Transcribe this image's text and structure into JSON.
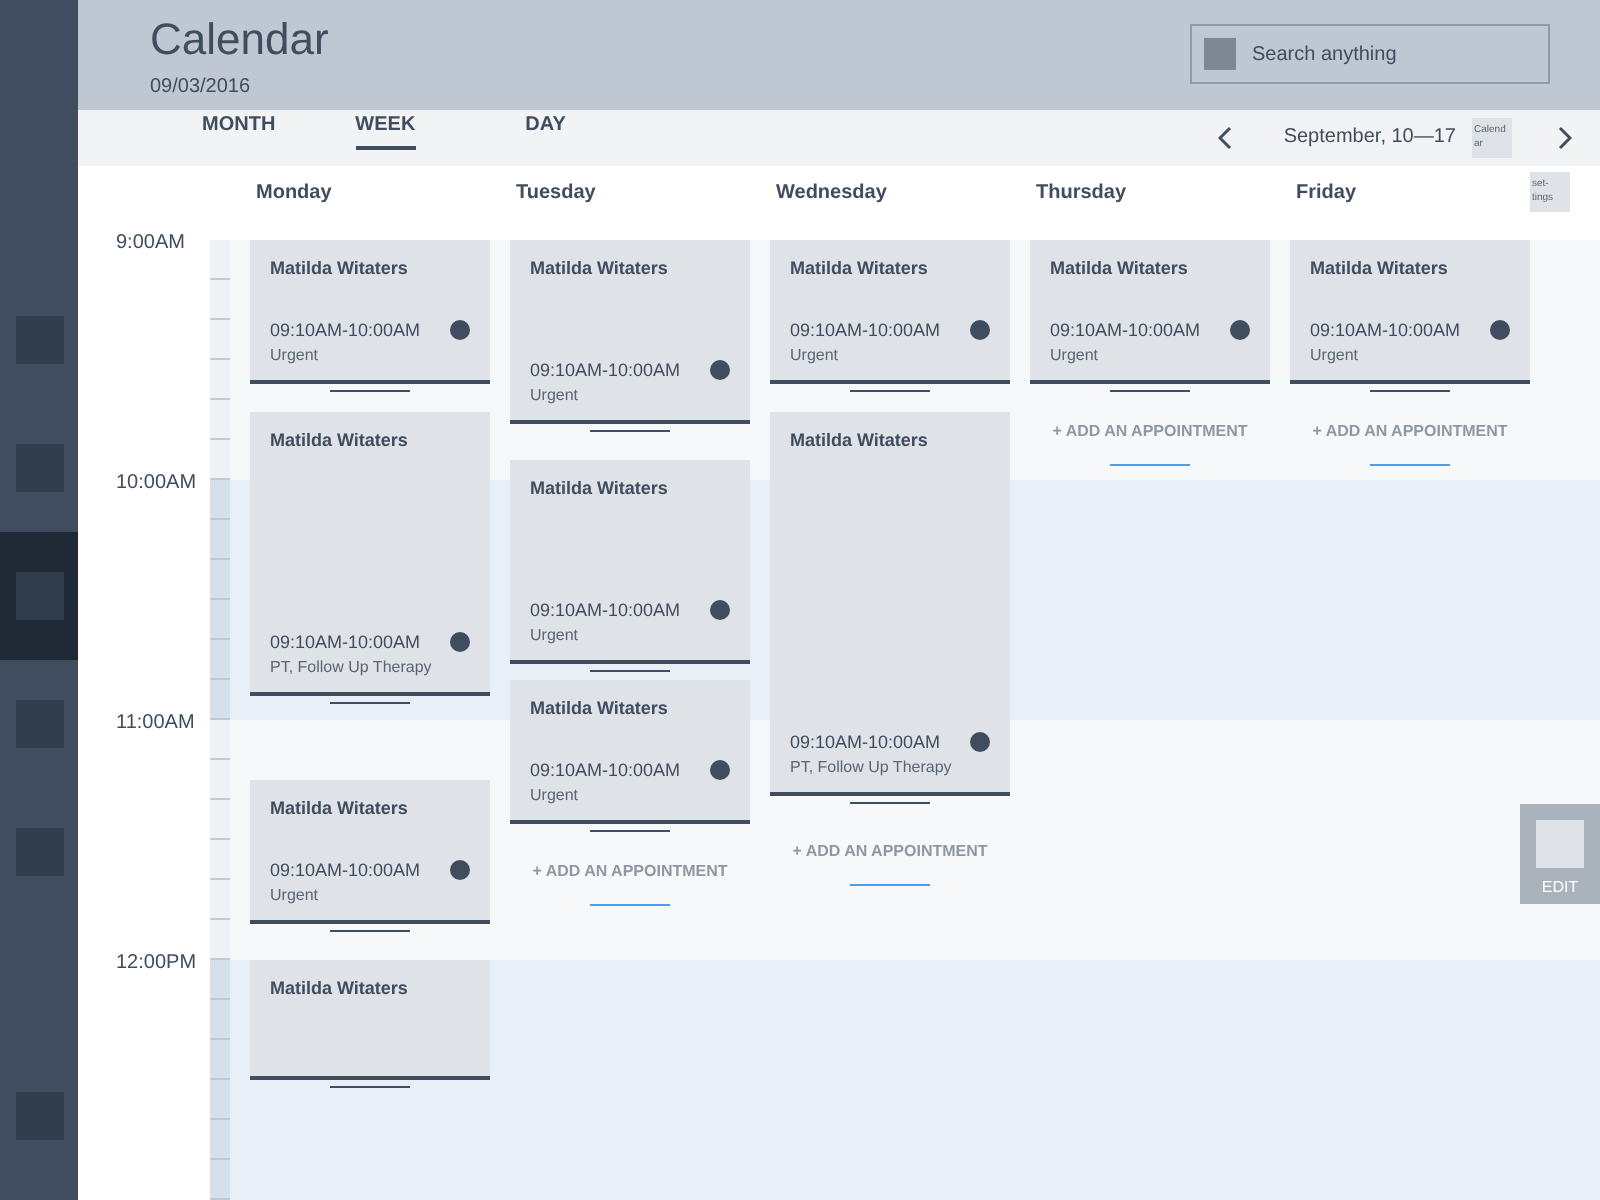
{
  "sidebar": {
    "items": [
      {
        "selected": false
      },
      {
        "selected": false
      },
      {
        "selected": true
      },
      {
        "selected": false
      },
      {
        "selected": false
      },
      {
        "selected": false
      }
    ]
  },
  "header": {
    "title": "Calendar",
    "date": "09/03/2016",
    "search": {
      "placeholder": "Search anything"
    }
  },
  "view_tabs": [
    {
      "label": "MONTH",
      "selected": false
    },
    {
      "label": "WEEK",
      "selected": true
    },
    {
      "label": "DAY",
      "selected": false
    }
  ],
  "date_nav": {
    "range": "September, 10—17",
    "calendar_button": "Calendar"
  },
  "settings_button": "set-tings",
  "times": [
    "9:00AM",
    "10:00AM",
    "11:00AM",
    "12:00PM"
  ],
  "days": [
    {
      "name": "Monday",
      "items": [
        {
          "kind": "appointment",
          "name": "Matilda Witaters",
          "time": "09:10AM-10:00AM",
          "note": "Urgent"
        },
        {
          "kind": "appointment",
          "name": "Matilda Witaters",
          "time": "09:10AM-10:00AM",
          "note": "PT, Follow Up Therapy"
        },
        {
          "kind": "appointment",
          "name": "Matilda Witaters",
          "time": "09:10AM-10:00AM",
          "note": "Urgent"
        },
        {
          "kind": "appointment",
          "name": "Matilda Witaters"
        }
      ]
    },
    {
      "name": "Tuesday",
      "items": [
        {
          "kind": "appointment",
          "name": "Matilda Witaters",
          "time": "09:10AM-10:00AM",
          "note": "Urgent"
        },
        {
          "kind": "appointment",
          "name": "Matilda Witaters",
          "time": "09:10AM-10:00AM",
          "note": "Urgent"
        },
        {
          "kind": "appointment",
          "name": "Matilda Witaters",
          "time": "09:10AM-10:00AM",
          "note": "Urgent"
        },
        {
          "kind": "add",
          "label": "+ ADD AN APPOINTMENT"
        }
      ]
    },
    {
      "name": "Wednesday",
      "items": [
        {
          "kind": "appointment",
          "name": "Matilda Witaters",
          "time": "09:10AM-10:00AM",
          "note": "Urgent"
        },
        {
          "kind": "appointment",
          "name": "Matilda Witaters",
          "time": "09:10AM-10:00AM",
          "note": "PT, Follow Up Therapy"
        },
        {
          "kind": "add",
          "label": "+ ADD AN APPOINTMENT"
        }
      ]
    },
    {
      "name": "Thursday",
      "items": [
        {
          "kind": "appointment",
          "name": "Matilda Witaters",
          "time": "09:10AM-10:00AM",
          "note": "Urgent"
        },
        {
          "kind": "add",
          "label": "+ ADD AN APPOINTMENT"
        }
      ]
    },
    {
      "name": "Friday",
      "items": [
        {
          "kind": "appointment",
          "name": "Matilda Witaters",
          "time": "09:10AM-10:00AM",
          "note": "Urgent"
        },
        {
          "kind": "add",
          "label": "+ ADD AN APPOINTMENT"
        }
      ]
    }
  ],
  "edit_button": "EDIT"
}
